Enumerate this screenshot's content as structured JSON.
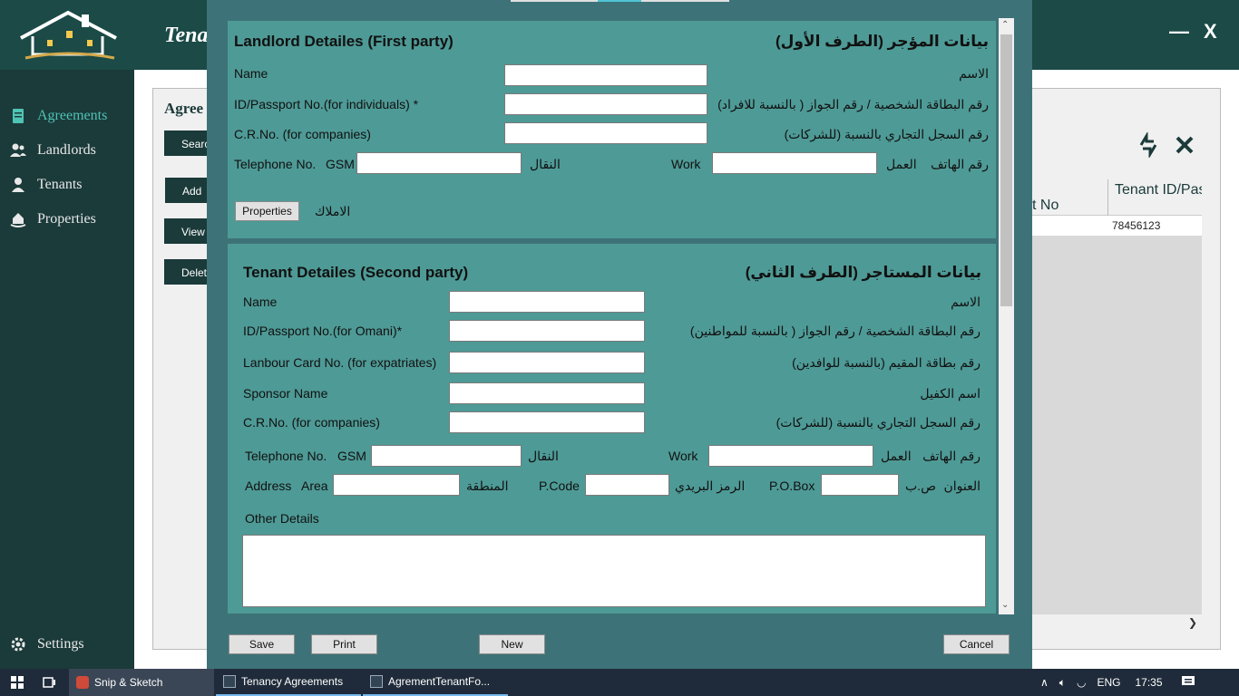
{
  "app": {
    "title": "Tena",
    "min_glyph": "—",
    "close_glyph": "X"
  },
  "sidebar": {
    "items": [
      {
        "label": "Agreements",
        "icon": "agreement-icon",
        "active": true
      },
      {
        "label": "Landlords",
        "icon": "users-icon"
      },
      {
        "label": "Tenants",
        "icon": "user-icon"
      },
      {
        "label": "Properties",
        "icon": "home-hand-icon"
      }
    ],
    "settings_label": "Settings"
  },
  "main": {
    "title": "Agree",
    "buttons": [
      "Searc",
      "Add",
      "View",
      "Delet"
    ],
    "table": {
      "col_no": "t No",
      "col_tenant": "Tenant ID/Passport N",
      "rows": [
        {
          "tenant_id": "78456123"
        }
      ]
    }
  },
  "dialog": {
    "landlord": {
      "title_en": "Landlord Detailes (First party)",
      "title_ar": "بيانات المؤجر (الطرف الأول)",
      "name_en": "Name",
      "name_ar": "الاسم",
      "id_en": "ID/Passport No.(for individuals) *",
      "id_ar": "رقم البطاقة الشخصية / رقم الجواز ( بالنسبة للافراد)",
      "cr_en": "C.R.No. (for companies)",
      "cr_ar": "رقم السجل التجاري بالنسبة (للشركات)",
      "tel_en": "Telephone No.",
      "gsm_en": "GSM",
      "gsm_ar": "النقال",
      "work_en": "Work",
      "work_ar": "العمل",
      "tel_ar": "رقم الهاتف",
      "properties_button": "Properties",
      "properties_ar": "الاملاك"
    },
    "tenant": {
      "title_en": "Tenant Detailes (Second party)",
      "title_ar": "بيانات المستاجر (الطرف الثاني)",
      "name_en": "Name",
      "name_ar": "الاسم",
      "id_en": "ID/Passport No.(for Omani)*",
      "id_ar": "رقم البطاقة الشخصية / رقم الجواز ( بالنسبة للمواطنين)",
      "labour_en": "Lanbour Card No. (for expatriates)",
      "labour_ar": "رقم بطاقة المقيم (بالنسبة للوافدين)",
      "sponsor_en": "Sponsor Name",
      "sponsor_ar": "اسم الكفيل",
      "cr_en": "C.R.No. (for companies)",
      "cr_ar": "رقم السجل التجاري بالنسبة (للشركات)",
      "tel_en": "Telephone No.",
      "gsm_en": "GSM",
      "gsm_ar": "النقال",
      "work_en": "Work",
      "work_ar": "العمل",
      "tel_ar": "رقم الهاتف",
      "address_en": "Address",
      "area_en": "Area",
      "area_ar": "المنطقة",
      "pcode_en": "P.Code",
      "pcode_ar": "الرمز البريدي",
      "pobox_en": "P.O.Box",
      "pobox_ar": "ص.ب",
      "address_ar": "العنوان",
      "other_en": "Other Details"
    },
    "buttons": {
      "save": "Save",
      "print": "Print",
      "new": "New",
      "cancel": "Cancel"
    }
  },
  "taskbar": {
    "items": [
      "Snip & Sketch",
      "Tenancy Agreements",
      "AgrementTenantFo..."
    ],
    "lang": "ENG",
    "time": "17:35"
  },
  "colors": {
    "header": "#1b4a47",
    "sidebar": "#1b3a3a",
    "dialog": "#3d7378",
    "section": "#4e9a96",
    "accent": "#4fc3b4"
  }
}
